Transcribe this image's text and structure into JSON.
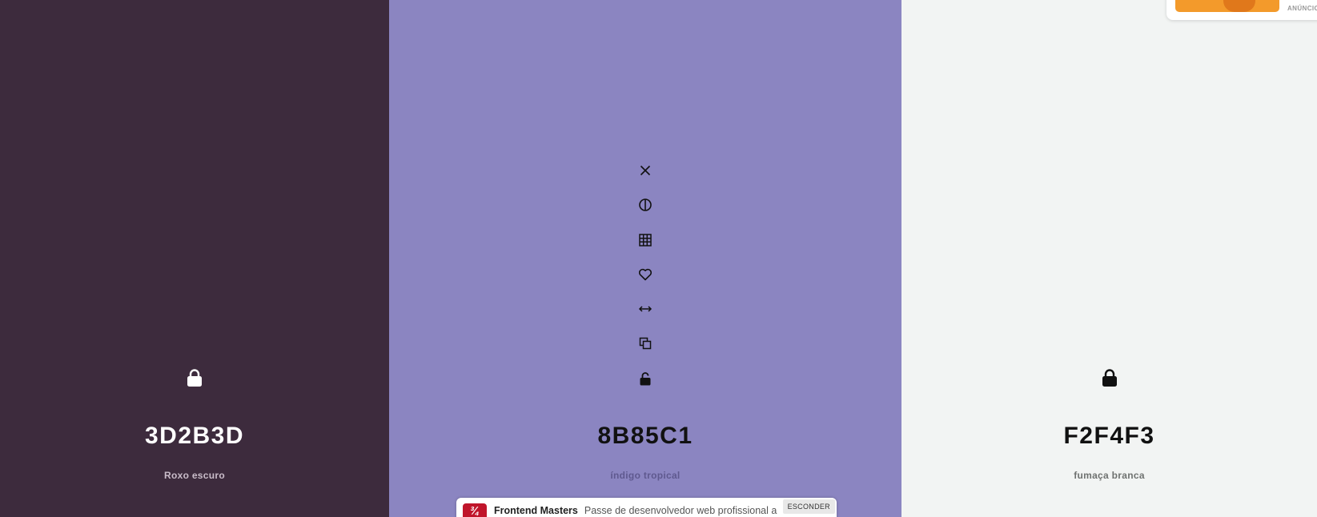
{
  "colors": [
    {
      "hex": "3D2B3D",
      "name": "Roxo escuro",
      "bg": "#3D2B3D",
      "text": "#ffffff",
      "locked": true
    },
    {
      "hex": "8B85C1",
      "name": "índigo tropical",
      "bg": "#8B85C1",
      "text": "#111111",
      "locked": false
    },
    {
      "hex": "F2F4F3",
      "name": "fumaça branca",
      "bg": "#F2F4F3",
      "text": "#111111",
      "locked": true
    }
  ],
  "toolbar": {
    "icons": [
      "close-icon",
      "contrast-icon",
      "shades-icon",
      "heart-icon",
      "drag-icon",
      "copy-icon",
      "unlock-icon"
    ]
  },
  "ad": {
    "logo": "¾",
    "brand": "Frontend Masters",
    "text": "Passe de desenvolvedor web profissional a",
    "hide_label": "ESCONDER"
  },
  "corner_ad": {
    "label": "ANÚNCIO"
  }
}
